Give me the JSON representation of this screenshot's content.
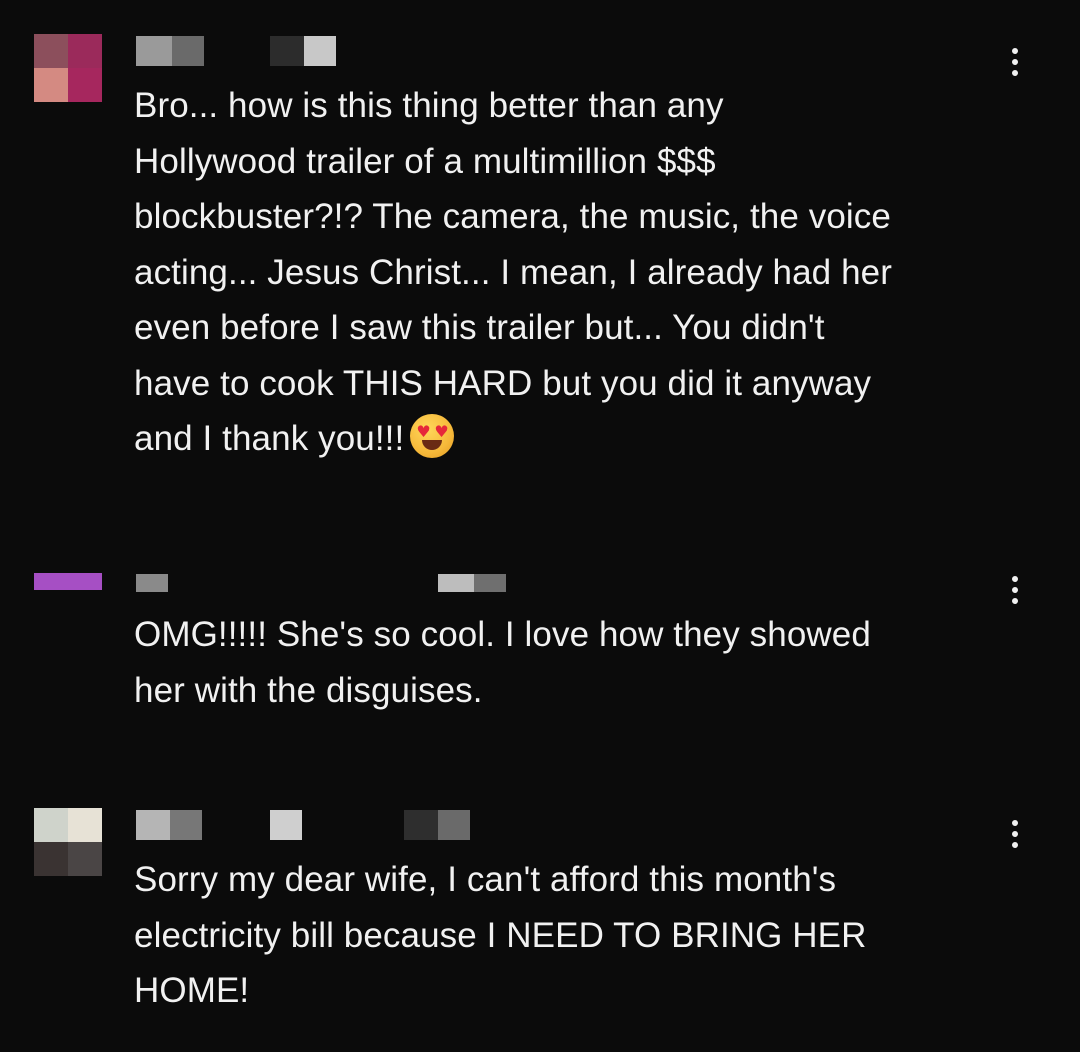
{
  "comments": [
    {
      "avatar_colors": [
        "#8c4f5c",
        "#9b2a5b",
        "#d48a82",
        "#a6275e"
      ],
      "author_redacted": true,
      "time_redacted": true,
      "text": "Bro... how is this thing better than any\nHollywood trailer of a multimillion $$$\nblockbuster?!? The camera, the music, the voice\nacting... Jesus Christ... I mean, I already had her\neven before I saw this trailer but... You didn't\nhave to cook THIS HARD but you did it anyway\nand I thank you!!!",
      "emoji": "smiling-face-with-heart-eyes",
      "more_icon": "vertical-ellipsis-icon"
    },
    {
      "avatar_colors": [
        "#a64fc4",
        "#a64fc4",
        "#0b0b0b",
        "#0b0b0b"
      ],
      "author_redacted": true,
      "time_redacted": true,
      "text": "OMG!!!!! She's so cool. I love how they showed\nher with the disguises.",
      "more_icon": "vertical-ellipsis-icon"
    },
    {
      "avatar_colors": [
        "#cfd3cb",
        "#e7e2d6",
        "#3a3332",
        "#4a4545"
      ],
      "author_redacted": true,
      "time_redacted": true,
      "text": "Sorry my dear wife, I can't afford this month's\nelectricity bill because I NEED TO BRING HER\nHOME!",
      "more_icon": "vertical-ellipsis-icon"
    }
  ]
}
